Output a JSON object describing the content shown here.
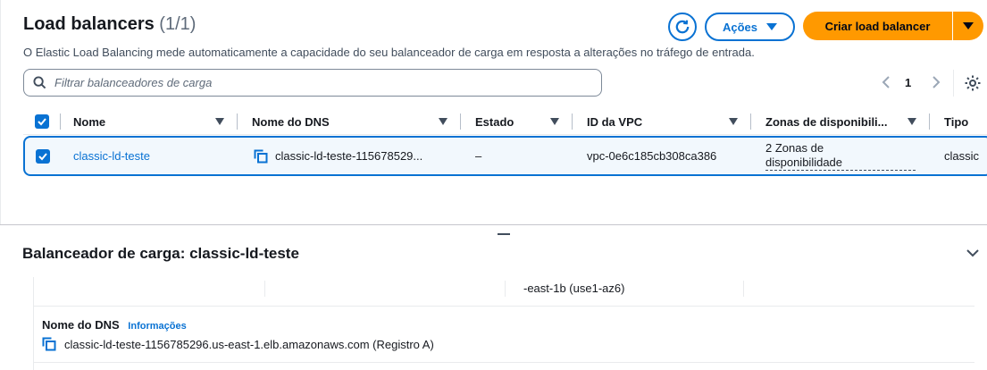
{
  "header": {
    "title": "Load balancers",
    "count": "(1/1)",
    "description": "O Elastic Load Balancing mede automaticamente a capacidade do seu balanceador de carga em resposta a alterações no tráfego de entrada.",
    "actions_label": "Ações",
    "create_label": "Criar load balancer"
  },
  "search": {
    "placeholder": "Filtrar balanceadores de carga"
  },
  "pagination": {
    "current_page": "1"
  },
  "table": {
    "columns": [
      "Nome",
      "Nome do DNS",
      "Estado",
      "ID da VPC",
      "Zonas de disponibili...",
      "Tipo"
    ],
    "rows": [
      {
        "name": "classic-ld-teste",
        "dns": "classic-ld-teste-115678529...",
        "state": "–",
        "vpc_id": "vpc-0e6c185cb308ca386",
        "zones_line1": "2 Zonas de",
        "zones_line2": "disponibilidade",
        "type": "classic",
        "selected": true
      }
    ]
  },
  "details": {
    "title": "Balanceador de carga: classic-ld-teste",
    "partial_zone": "-east-1b (use1-az6)",
    "dns_label": "Nome do DNS",
    "info_link": "Informações",
    "dns_value": "classic-ld-teste-1156785296.us-east-1.elb.amazonaws.com (Registro A)"
  },
  "colors": {
    "accent": "#0972d3",
    "primary_button": "#ff9900",
    "selected_row_bg": "#f2f8fd"
  },
  "icons": [
    "refresh-icon",
    "caret-down-icon",
    "search-icon",
    "chevron-left-icon",
    "chevron-right-icon",
    "settings-icon",
    "checkbox-checked-icon",
    "sort-icon",
    "copy-icon",
    "chevron-down-icon"
  ]
}
